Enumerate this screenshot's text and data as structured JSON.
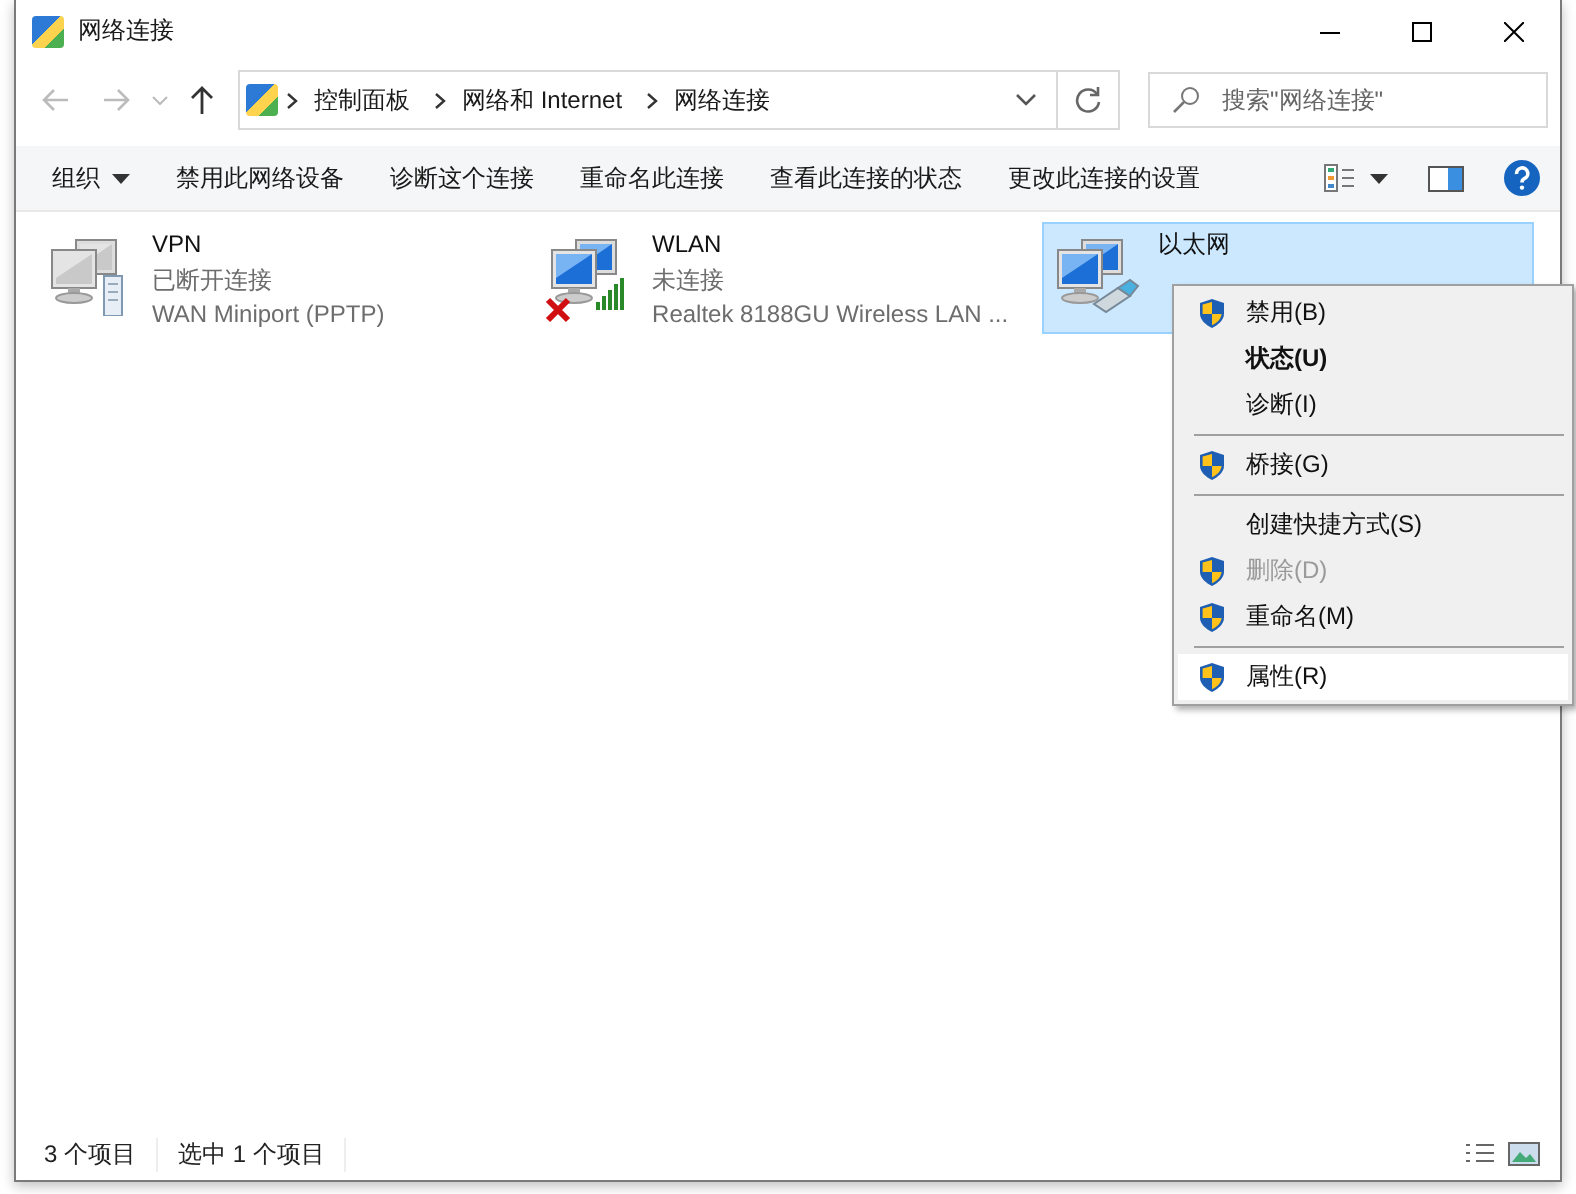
{
  "window": {
    "title": "网络连接"
  },
  "address": {
    "crumbs": [
      "控制面板",
      "网络和 Internet",
      "网络连接"
    ]
  },
  "search": {
    "placeholder": "搜索\"网络连接\""
  },
  "toolbar": {
    "items": [
      {
        "label": "组织",
        "dropdown": true
      },
      {
        "label": "禁用此网络设备",
        "dropdown": false
      },
      {
        "label": "诊断这个连接",
        "dropdown": false
      },
      {
        "label": "重命名此连接",
        "dropdown": false
      },
      {
        "label": "查看此连接的状态",
        "dropdown": false
      },
      {
        "label": "更改此连接的设置",
        "dropdown": false
      }
    ]
  },
  "connections": [
    {
      "kind": "vpn",
      "name": "VPN",
      "status": "已断开连接",
      "device": "WAN Miniport (PPTP)",
      "selected": false,
      "disconnected": false
    },
    {
      "kind": "wireless",
      "name": "WLAN",
      "status": "未连接",
      "device": "Realtek 8188GU Wireless LAN ...",
      "selected": false,
      "disconnected": true
    },
    {
      "kind": "ethernet",
      "name": "以太网",
      "selected": true,
      "disconnected": false
    }
  ],
  "context_menu": {
    "items": [
      {
        "kind": "item",
        "label": "禁用(B)",
        "shield": true,
        "bold": false,
        "disabled": false,
        "hovered": false
      },
      {
        "kind": "item",
        "label": "状态(U)",
        "shield": false,
        "bold": true,
        "disabled": false,
        "hovered": false
      },
      {
        "kind": "item",
        "label": "诊断(I)",
        "shield": false,
        "bold": false,
        "disabled": false,
        "hovered": false
      },
      {
        "kind": "separator"
      },
      {
        "kind": "item",
        "label": "桥接(G)",
        "shield": true,
        "bold": false,
        "disabled": false,
        "hovered": false
      },
      {
        "kind": "separator"
      },
      {
        "kind": "item",
        "label": "创建快捷方式(S)",
        "shield": false,
        "bold": false,
        "disabled": false,
        "hovered": false
      },
      {
        "kind": "item",
        "label": "删除(D)",
        "shield": true,
        "bold": false,
        "disabled": true,
        "hovered": false
      },
      {
        "kind": "item",
        "label": "重命名(M)",
        "shield": true,
        "bold": false,
        "disabled": false,
        "hovered": false
      },
      {
        "kind": "separator"
      },
      {
        "kind": "item",
        "label": "属性(R)",
        "shield": true,
        "bold": false,
        "disabled": false,
        "hovered": true
      }
    ]
  },
  "status_bar": {
    "items": [
      "3 个项目",
      "选中 1 个项目"
    ]
  }
}
